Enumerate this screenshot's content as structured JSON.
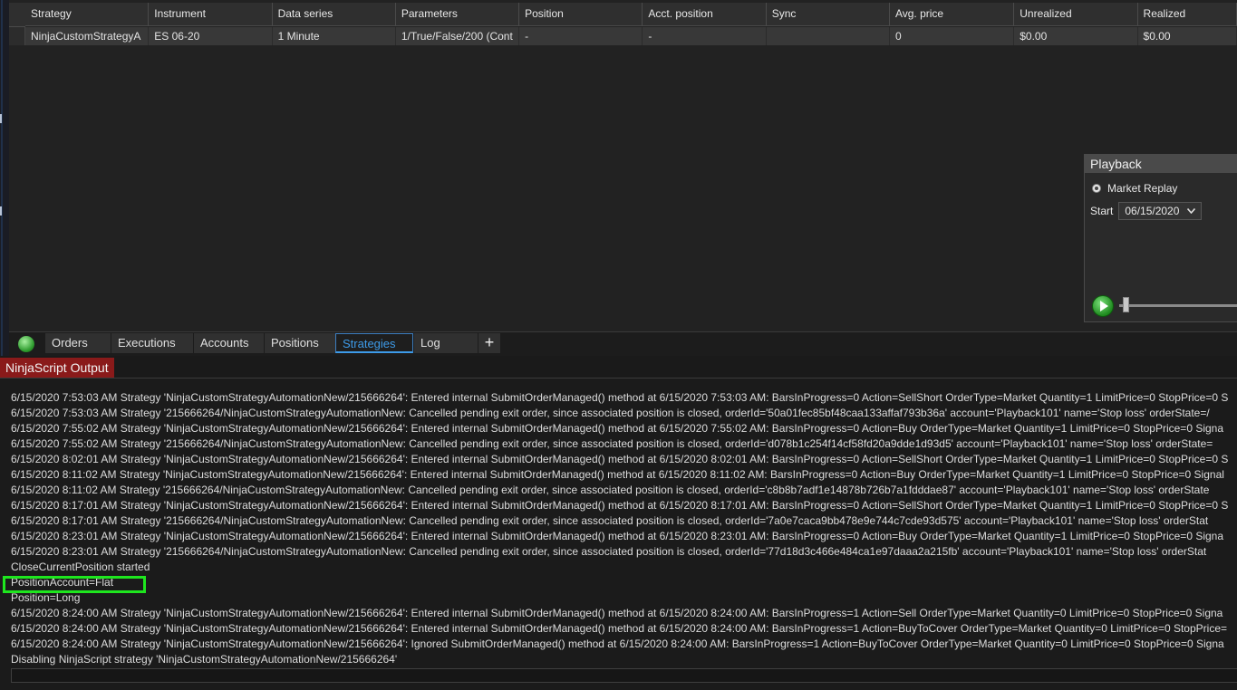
{
  "strategies_grid": {
    "columns": [
      "Strategy",
      "Instrument",
      "Data series",
      "Parameters",
      "Position",
      "Acct. position",
      "Sync",
      "Avg. price",
      "Unrealized",
      "Realized"
    ],
    "rows": [
      [
        "NinjaCustomStrategyA",
        "ES 06-20",
        "1 Minute",
        "1/True/False/200 (Cont",
        "-",
        "-",
        "",
        "0",
        "$0.00",
        "$0.00"
      ]
    ]
  },
  "playback": {
    "title": "Playback",
    "mode_label": "Market Replay",
    "start_label": "Start",
    "start_date": "06/15/2020",
    "dropdown_icon": "chevron-down-icon",
    "play_icon": "play-icon"
  },
  "tabs": {
    "status_icon": "connection-status-green",
    "items": [
      "Orders",
      "Executions",
      "Accounts",
      "Positions",
      "Strategies",
      "Log"
    ],
    "active": "Strategies",
    "add_label": "+"
  },
  "output": {
    "title": "NinjaScript Output",
    "highlight_color": "#1ee61e",
    "lines": [
      "6/15/2020 7:53:03 AM Strategy 'NinjaCustomStrategyAutomationNew/215666264': Entered internal SubmitOrderManaged() method at 6/15/2020 7:53:03 AM: BarsInProgress=0 Action=SellShort OrderType=Market Quantity=1 LimitPrice=0 StopPrice=0 S",
      "6/15/2020 7:53:03 AM Strategy '215666264/NinjaCustomStrategyAutomationNew: Cancelled pending exit order, since associated position is closed, orderId='50a01fec85bf48caa133affaf793b36a' account='Playback101' name='Stop loss' orderState=/",
      "6/15/2020 7:55:02 AM Strategy 'NinjaCustomStrategyAutomationNew/215666264': Entered internal SubmitOrderManaged() method at 6/15/2020 7:55:02 AM: BarsInProgress=0 Action=Buy OrderType=Market Quantity=1 LimitPrice=0 StopPrice=0 Signa",
      "6/15/2020 7:55:02 AM Strategy '215666264/NinjaCustomStrategyAutomationNew: Cancelled pending exit order, since associated position is closed, orderId='d078b1c254f14cf58fd20a9dde1d93d5' account='Playback101' name='Stop loss' orderState=",
      "6/15/2020 8:02:01 AM Strategy 'NinjaCustomStrategyAutomationNew/215666264': Entered internal SubmitOrderManaged() method at 6/15/2020 8:02:01 AM: BarsInProgress=0 Action=SellShort OrderType=Market Quantity=1 LimitPrice=0 StopPrice=0 S",
      "6/15/2020 8:11:02 AM Strategy 'NinjaCustomStrategyAutomationNew/215666264': Entered internal SubmitOrderManaged() method at 6/15/2020 8:11:02 AM: BarsInProgress=0 Action=Buy OrderType=Market Quantity=1 LimitPrice=0 StopPrice=0 Signal",
      "6/15/2020 8:11:02 AM Strategy '215666264/NinjaCustomStrategyAutomationNew: Cancelled pending exit order, since associated position is closed, orderId='c8b8b7adf1e14878b726b7a1fdddae87' account='Playback101' name='Stop loss' orderState",
      "6/15/2020 8:17:01 AM Strategy 'NinjaCustomStrategyAutomationNew/215666264': Entered internal SubmitOrderManaged() method at 6/15/2020 8:17:01 AM: BarsInProgress=0 Action=SellShort OrderType=Market Quantity=1 LimitPrice=0 StopPrice=0 S",
      "6/15/2020 8:17:01 AM Strategy '215666264/NinjaCustomStrategyAutomationNew: Cancelled pending exit order, since associated position is closed, orderId='7a0e7caca9bb478e9e744c7cde93d575' account='Playback101' name='Stop loss' orderStat",
      "6/15/2020 8:23:01 AM Strategy 'NinjaCustomStrategyAutomationNew/215666264': Entered internal SubmitOrderManaged() method at 6/15/2020 8:23:01 AM: BarsInProgress=0 Action=Buy OrderType=Market Quantity=1 LimitPrice=0 StopPrice=0 Signa",
      "6/15/2020 8:23:01 AM Strategy '215666264/NinjaCustomStrategyAutomationNew: Cancelled pending exit order, since associated position is closed, orderId='77d18d3c466e484ca1e97daaa2a215fb' account='Playback101' name='Stop loss' orderStat",
      "CloseCurrentPosition started",
      "PositionAccount=Flat",
      "Position=Long",
      "6/15/2020 8:24:00 AM Strategy 'NinjaCustomStrategyAutomationNew/215666264': Entered internal SubmitOrderManaged() method at 6/15/2020 8:24:00 AM: BarsInProgress=1 Action=Sell OrderType=Market Quantity=0 LimitPrice=0 StopPrice=0 Signa",
      "6/15/2020 8:24:00 AM Strategy 'NinjaCustomStrategyAutomationNew/215666264': Entered internal SubmitOrderManaged() method at 6/15/2020 8:24:00 AM: BarsInProgress=1 Action=BuyToCover OrderType=Market Quantity=0 LimitPrice=0 StopPrice=",
      "6/15/2020 8:24:00 AM Strategy 'NinjaCustomStrategyAutomationNew/215666264': Ignored SubmitOrderManaged() method at 6/15/2020 8:24:00 AM: BarsInProgress=1 Action=BuyToCover OrderType=Market Quantity=0 LimitPrice=0 StopPrice=0 Signa",
      "Disabling NinjaScript strategy 'NinjaCustomStrategyAutomationNew/215666264'"
    ]
  }
}
